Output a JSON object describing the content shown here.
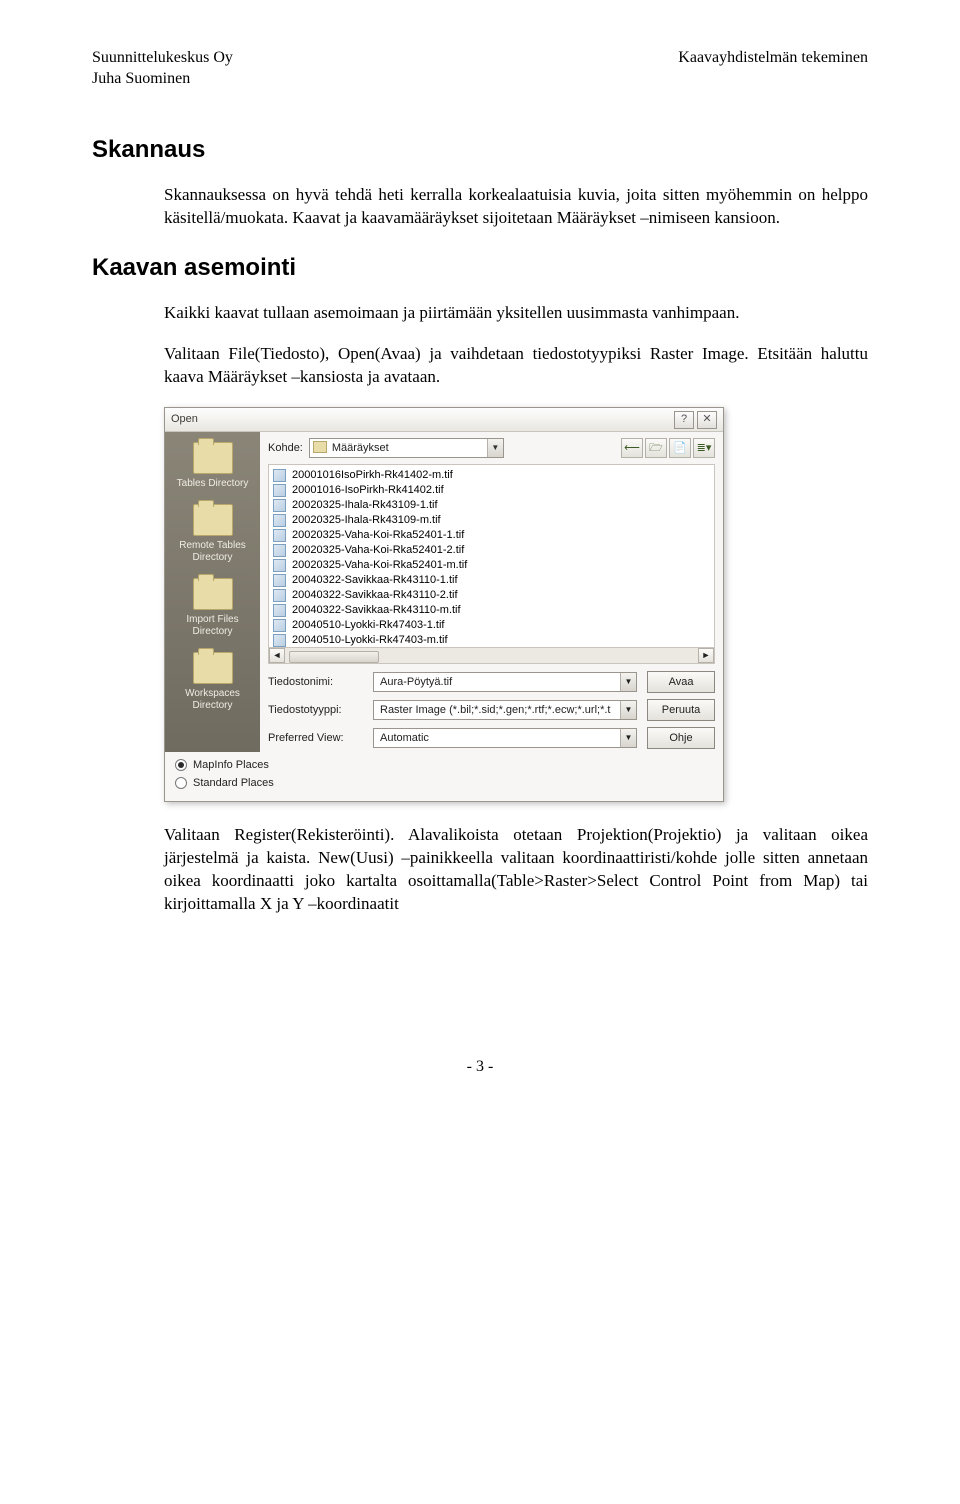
{
  "header": {
    "left1": "Suunnittelukeskus Oy",
    "left2": "Juha Suominen",
    "right": "Kaavayhdistelmän tekeminen"
  },
  "section1": {
    "title": "Skannaus",
    "para": "Skannauksessa on hyvä tehdä heti kerralla korkealaatuisia kuvia, joita sitten myöhemmin on helppo käsitellä/muokata. Kaavat ja kaavamääräykset sijoitetaan Määräykset –nimiseen kansioon."
  },
  "section2": {
    "title": "Kaavan asemointi",
    "para1": "Kaikki kaavat tullaan asemoimaan ja piirtämään yksitellen uusimmasta vanhimpaan.",
    "para2": "Valitaan File(Tiedosto), Open(Avaa) ja vaihdetaan tiedostotyypiksi Raster Image. Etsitään haluttu kaava Määräykset –kansiosta ja avataan.",
    "para3": "Valitaan Register(Rekisteröinti). Alavalikoista otetaan Projektion(Projektio) ja valitaan oikea järjestelmä ja kaista. New(Uusi) –painikkeella valitaan koordinaattiristi/kohde jolle sitten annetaan oikea koordinaatti joko kartalta osoittamalla(Table>Raster>Select Control Point from Map) tai kirjoittamalla X ja Y –koordinaatit"
  },
  "dialog": {
    "title": "Open",
    "help_glyph": "?",
    "close_glyph": "✕",
    "kohde_label": "Kohde:",
    "kohde_value": "Määräykset",
    "sidebar": [
      "Tables Directory",
      "Remote Tables Directory",
      "Import Files Directory",
      "Workspaces Directory"
    ],
    "toolbar_icons": [
      "⟵",
      "🗁",
      "📄",
      "≣▾"
    ],
    "files": [
      "20001016IsoPirkh-Rk41402-m.tif",
      "20001016-IsoPirkh-Rk41402.tif",
      "20020325-Ihala-Rk43109-1.tif",
      "20020325-Ihala-Rk43109-m.tif",
      "20020325-Vaha-Koi-Rka52401-1.tif",
      "20020325-Vaha-Koi-Rka52401-2.tif",
      "20020325-Vaha-Koi-Rka52401-m.tif",
      "20040322-Savikkaa-Rk43110-1.tif",
      "20040322-Savikkaa-Rk43110-2.tif",
      "20040322-Savikkaa-Rk43110-m.tif",
      "20040510-Lyokki-Rk47403-1.tif",
      "20040510-Lyokki-Rk47403-m.tif"
    ],
    "filename_label": "Tiedostonimi:",
    "filename_value": "Aura-Pöytyä.tif",
    "filetype_label": "Tiedostotyyppi:",
    "filetype_value": "Raster Image (*.bil;*.sid;*.gen;*.rtf;*.ecw;*.url;*.t",
    "prefview_label": "Preferred View:",
    "prefview_value": "Automatic",
    "btn_open": "Avaa",
    "btn_cancel": "Peruuta",
    "btn_help": "Ohje",
    "radio1": "MapInfo Places",
    "radio2": "Standard Places"
  },
  "footer": "- 3 -"
}
